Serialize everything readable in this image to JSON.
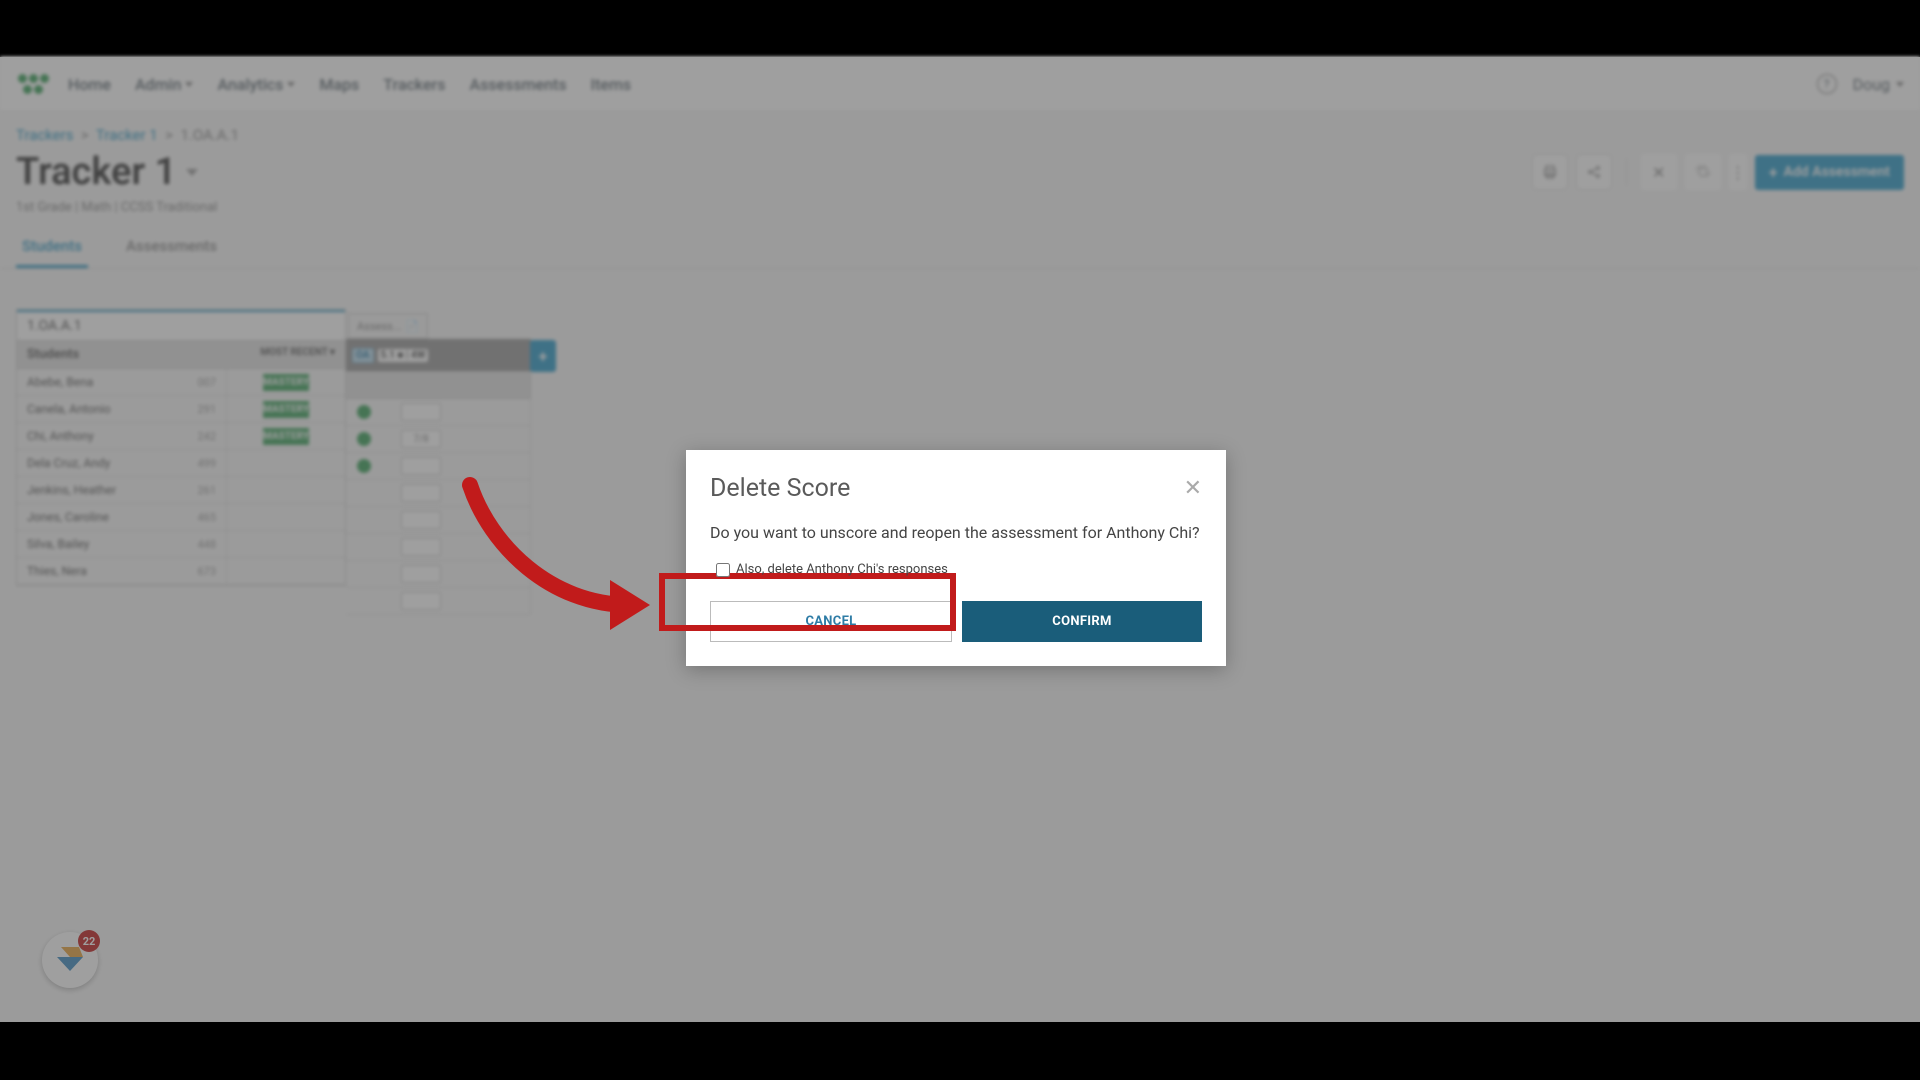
{
  "nav": {
    "items": [
      "Home",
      "Admin",
      "Analytics",
      "Maps",
      "Trackers",
      "Assessments",
      "Items"
    ],
    "user": "Doug"
  },
  "breadcrumb": {
    "a": "Trackers",
    "b": "Tracker 1",
    "c": "1.OA.A.1"
  },
  "page": {
    "title": "Tracker 1",
    "sub": "1st Grade  |  Math  |  CCSS Traditional",
    "add_label": "Add Assessment"
  },
  "tabs": {
    "a": "Students",
    "b": "Assessments"
  },
  "table": {
    "standard": "1.OA.A.1",
    "students_label": "Students",
    "mostrecent": "MOST RECENT",
    "assess_label": "Assess...",
    "pill_type": "OA",
    "assess_sub": "5.1  ■  |  4W",
    "col2": "",
    "rows": [
      {
        "name": "Abebe, Bena",
        "id": "007",
        "mastery": "MASTERY",
        "dot": true,
        "score": ""
      },
      {
        "name": "Canela, Antonio",
        "id": "291",
        "mastery": "MASTERY",
        "dot": true,
        "score": "7/8"
      },
      {
        "name": "Chi, Anthony",
        "id": "242",
        "mastery": "MASTERY",
        "dot": true,
        "score": ""
      },
      {
        "name": "Dela Cruz, Andy",
        "id": "499",
        "mastery": "",
        "dot": false,
        "score": ""
      },
      {
        "name": "Jenkins, Heather",
        "id": "261",
        "mastery": "",
        "dot": false,
        "score": ""
      },
      {
        "name": "Jones, Caroline",
        "id": "465",
        "mastery": "",
        "dot": false,
        "score": ""
      },
      {
        "name": "Silva, Bailey",
        "id": "448",
        "mastery": "",
        "dot": false,
        "score": ""
      },
      {
        "name": "Thies, Nera",
        "id": "673",
        "mastery": "",
        "dot": false,
        "score": ""
      }
    ]
  },
  "modal": {
    "title": "Delete Score",
    "text": "Do you want to unscore and reopen the assessment for Anthony Chi?",
    "checkbox": "Also, delete Anthony Chi's responses",
    "cancel": "CANCEL",
    "confirm": "CONFIRM"
  },
  "floating": {
    "count": "22"
  }
}
